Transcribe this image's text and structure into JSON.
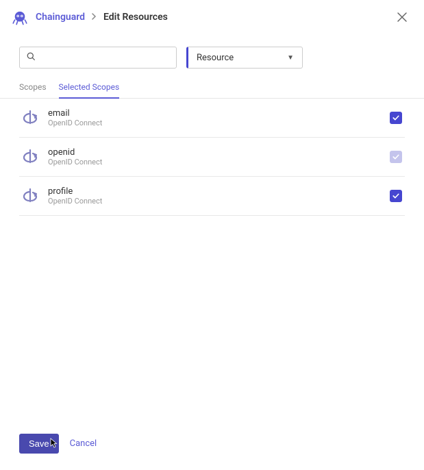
{
  "header": {
    "breadcrumb_link": "Chainguard",
    "breadcrumb_title": "Edit Resources"
  },
  "search": {
    "placeholder": ""
  },
  "resource_select": {
    "label": "Resource"
  },
  "tabs": [
    {
      "label": "Scopes",
      "active": false
    },
    {
      "label": "Selected Scopes",
      "active": true
    }
  ],
  "scopes": [
    {
      "name": "email",
      "resource": "OpenID Connect",
      "checked": true,
      "disabled": false
    },
    {
      "name": "openid",
      "resource": "OpenID Connect",
      "checked": true,
      "disabled": true
    },
    {
      "name": "profile",
      "resource": "OpenID Connect",
      "checked": true,
      "disabled": false
    }
  ],
  "footer": {
    "save_label": "Save",
    "cancel_label": "Cancel"
  }
}
